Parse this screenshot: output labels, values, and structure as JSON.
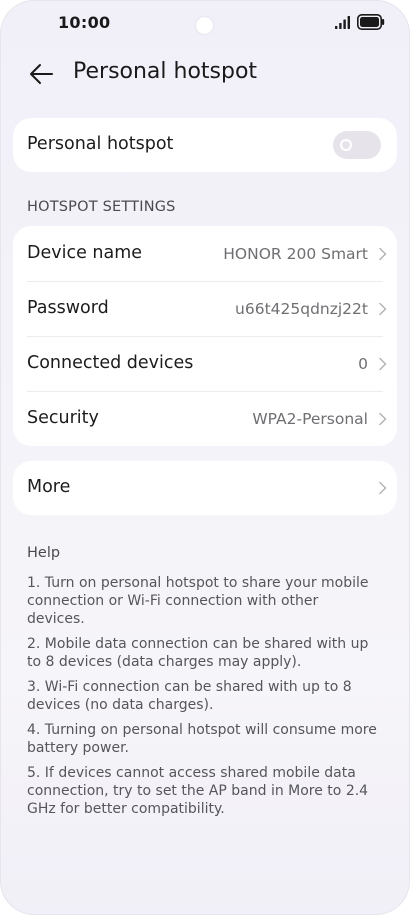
{
  "status_bar": {
    "time": "10:00"
  },
  "header": {
    "back_icon": "arrow-left-icon",
    "title": "Personal hotspot"
  },
  "hotspot_toggle": {
    "label": "Personal hotspot",
    "enabled": false
  },
  "settings": {
    "section_title": "HOTSPOT SETTINGS",
    "rows": [
      {
        "label": "Device name",
        "value": "HONOR 200 Smart"
      },
      {
        "label": "Password",
        "value": "u66t425qdnzj22t"
      },
      {
        "label": "Connected devices",
        "value": "0"
      },
      {
        "label": "Security",
        "value": "WPA2-Personal"
      }
    ]
  },
  "more": {
    "label": "More"
  },
  "help": {
    "title": "Help",
    "items": [
      "1. Turn on personal hotspot to share your mobile connection or Wi-Fi connection with other devices.",
      "2. Mobile data connection can be shared with up to 8 devices (data charges may apply).",
      "3. Wi-Fi connection can be shared with up to 8 devices (no data charges).",
      "4. Turning on personal hotspot will consume more battery power.",
      "5. If devices cannot access shared mobile data connection, try to set the AP band in More to 2.4 GHz for better compatibility."
    ]
  },
  "colors": {
    "background": "#f3f2f8",
    "card": "#ffffff",
    "text_primary": "#1c1c1c",
    "text_secondary": "#6f6f73",
    "toggle_off": "#e6e4ea"
  }
}
